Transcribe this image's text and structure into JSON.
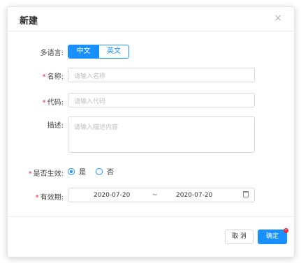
{
  "modal": {
    "title": "新建",
    "close_glyph": "×"
  },
  "form": {
    "language": {
      "label": "多语言:",
      "options": [
        "中文",
        "英文"
      ],
      "selected": "中文"
    },
    "name": {
      "label": "名称:",
      "placeholder": "请输入名称",
      "required": "*"
    },
    "code": {
      "label": "代码:",
      "placeholder": "请输入代码",
      "required": "*"
    },
    "description": {
      "label": "描述:",
      "placeholder": "请输入描述内容"
    },
    "effective": {
      "label": "是否生效:",
      "required": "*",
      "options": [
        "是",
        "否"
      ],
      "selected": "是"
    },
    "validity": {
      "label": "有效期:",
      "required": "*",
      "start": "2020-07-20",
      "separator": "~",
      "end": "2020-07-20"
    }
  },
  "footer": {
    "cancel_label": "取 消",
    "ok_label": "确定",
    "badge": "+"
  },
  "colors": {
    "primary": "#1890ff",
    "required": "#f5222d",
    "border": "#d9d9d9"
  },
  "icons": {
    "close": "close-icon",
    "calendar": "calendar-icon",
    "badge": "plus-badge-icon"
  }
}
